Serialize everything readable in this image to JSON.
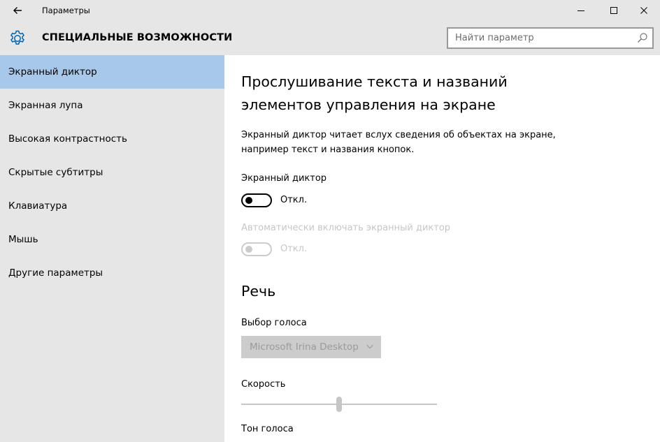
{
  "window": {
    "title": "Параметры",
    "back_icon": "arrow-left-icon",
    "minimize_icon": "minimize-icon",
    "maximize_icon": "maximize-icon",
    "close_icon": "close-icon"
  },
  "header": {
    "icon": "gear-icon",
    "title": "СПЕЦИАЛЬНЫЕ ВОЗМОЖНОСТИ",
    "search_placeholder": "Найти параметр",
    "search_icon": "search-icon"
  },
  "sidebar": {
    "selected_index": 0,
    "items": [
      {
        "label": "Экранный диктор"
      },
      {
        "label": "Экранная лупа"
      },
      {
        "label": "Высокая контрастность"
      },
      {
        "label": "Скрытые субтитры"
      },
      {
        "label": "Клавиатура"
      },
      {
        "label": "Мышь"
      },
      {
        "label": "Другие параметры"
      }
    ]
  },
  "main": {
    "heading": "Прослушивание текста и названий элементов управления на экране",
    "description": "Экранный диктор читает вслух сведения об объектах на экране, например текст и названия кнопок.",
    "narrator": {
      "label": "Экранный диктор",
      "state": "Откл.",
      "on": false
    },
    "auto_start": {
      "label": "Автоматически включать экранный диктор",
      "state": "Откл.",
      "on": false,
      "disabled": true
    },
    "speech_heading": "Речь",
    "voice": {
      "label": "Выбор голоса",
      "selected": "Microsoft Irina Desktop",
      "disabled": true
    },
    "speed": {
      "label": "Скорость",
      "value_fraction": 0.5,
      "disabled": true
    },
    "pitch": {
      "label": "Тон голоса"
    }
  },
  "colors": {
    "accent": "#0063b1",
    "selected_nav": "#a8c8ea",
    "chrome_bg": "#e6e6e6",
    "disabled_text": "#c6c6c6"
  }
}
